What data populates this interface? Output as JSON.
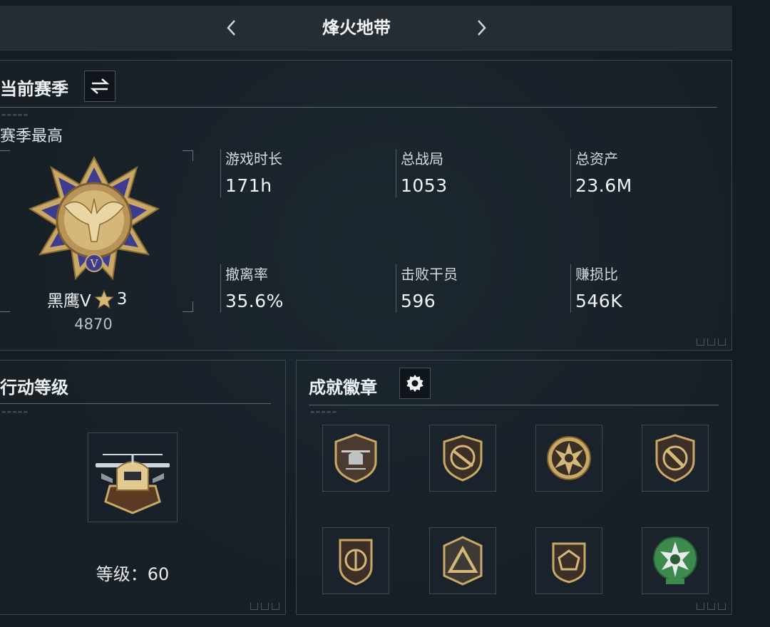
{
  "header": {
    "title": "烽火地带"
  },
  "season": {
    "title": "当前赛季",
    "subhead": "赛季最高",
    "rank": {
      "name": "黑鹰V",
      "stars": "3",
      "score": "4870",
      "emblem_numeral": "V"
    },
    "stats": [
      {
        "label": "游戏时长",
        "value": "171h"
      },
      {
        "label": "总战局",
        "value": "1053"
      },
      {
        "label": "总资产",
        "value": "23.6M"
      },
      {
        "label": "撤离率",
        "value": "35.6%"
      },
      {
        "label": "击败干员",
        "value": "596"
      },
      {
        "label": "赚损比",
        "value": "546K"
      }
    ]
  },
  "level": {
    "title": "行动等级",
    "level_text": "等级：60"
  },
  "badges": {
    "title": "成就徽章",
    "items": [
      {
        "icon": "helicopter-shield-icon"
      },
      {
        "icon": "rifle-shield-icon"
      },
      {
        "icon": "skull-star-icon"
      },
      {
        "icon": "knife-shield-icon"
      },
      {
        "icon": "round-shield-icon"
      },
      {
        "icon": "triangle-shield-icon"
      },
      {
        "icon": "gem-shield-icon"
      },
      {
        "icon": "green-skull-star-icon"
      }
    ]
  },
  "colors": {
    "background": "#151d24",
    "panel_border": "#3a454d",
    "gold": "#c9a866",
    "badge_green": "#3c8a4e",
    "emblem_blue": "#3d3c8f"
  }
}
